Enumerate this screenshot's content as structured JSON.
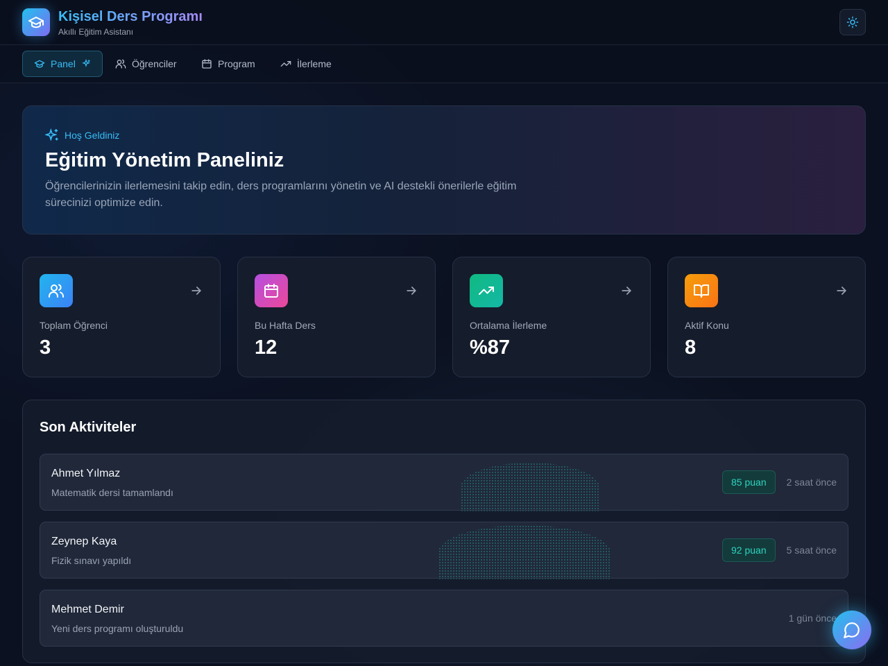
{
  "header": {
    "title": "Kişisel Ders Programı",
    "subtitle": "Akıllı Eğitim Asistanı",
    "logo_icon": "graduation-cap-icon",
    "theme_icon": "sun-icon"
  },
  "nav": {
    "items": [
      {
        "label": "Panel",
        "icon": "graduation-cap-icon",
        "active": true
      },
      {
        "label": "Öğrenciler",
        "icon": "users-icon",
        "active": false
      },
      {
        "label": "Program",
        "icon": "calendar-icon",
        "active": false
      },
      {
        "label": "İlerleme",
        "icon": "trending-up-icon",
        "active": false
      }
    ]
  },
  "hero": {
    "tag": "Hoş Geldiniz",
    "title": "Eğitim Yönetim Paneliniz",
    "text": "Öğrencilerinizin ilerlemesini takip edin, ders programlarını yönetin ve AI destekli önerilerle eğitim sürecinizi optimize edin."
  },
  "stats": [
    {
      "label": "Toplam Öğrenci",
      "value": "3",
      "icon": "users-icon",
      "color": "#2fa4ef"
    },
    {
      "label": "Bu Hafta Ders",
      "value": "12",
      "icon": "calendar-icon",
      "color": "#c84fd6"
    },
    {
      "label": "Ortalama İlerleme",
      "value": "%87",
      "icon": "trending-up-icon",
      "color": "#14b89a"
    },
    {
      "label": "Aktif Konu",
      "value": "8",
      "icon": "book-open-icon",
      "color": "#f88a1e"
    }
  ],
  "activities": {
    "title": "Son Aktiviteler",
    "items": [
      {
        "name": "Ahmet Yılmaz",
        "desc": "Matematik dersi tamamlandı",
        "score": "85 puan",
        "time": "2 saat önce"
      },
      {
        "name": "Zeynep Kaya",
        "desc": "Fizik sınavı yapıldı",
        "score": "92 puan",
        "time": "5 saat önce"
      },
      {
        "name": "Mehmet Demir",
        "desc": "Yeni ders programı oluşturuldu",
        "score": "",
        "time": "1 gün önce"
      }
    ]
  },
  "chat": {
    "icon": "chat-bubble-icon"
  }
}
